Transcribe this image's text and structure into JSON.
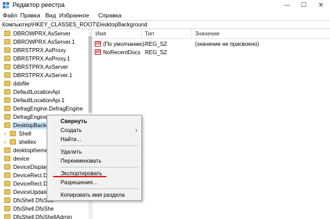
{
  "window": {
    "title": "Редактор реестра",
    "minimize_glyph": "—",
    "maximize_glyph": "☐",
    "close_glyph": "✕"
  },
  "menu": [
    "Файл",
    "Правка",
    "Вид",
    "Избранное",
    "Справка"
  ],
  "address": "Компьютер\\HKEY_CLASSES_ROOT\\DesktopBackground",
  "tree": {
    "items": [
      {
        "label": "DBROWPRX.AsServer"
      },
      {
        "label": "DBROWPRX.AsServer.1"
      },
      {
        "label": "DBRSTPRX.AsProxy"
      },
      {
        "label": "DBRSTPRX.AsProxy.1"
      },
      {
        "label": "DBRSTPRX.AsServer"
      },
      {
        "label": "DBRSTPRX.AsServer.1"
      },
      {
        "label": "ddsfile"
      },
      {
        "label": "DefaultLocationApi"
      },
      {
        "label": "DefaultLocationApi.1"
      },
      {
        "label": "DefragEngine.DefragEngine"
      },
      {
        "label": "DefragEngine.DefragEngine.1"
      },
      {
        "label": "DesktopBackground"
      },
      {
        "label": "Shell"
      },
      {
        "label": "shellex"
      },
      {
        "label": "desktoptheme"
      },
      {
        "label": "device"
      },
      {
        "label": "DeviceDisplayO"
      },
      {
        "label": "DeviceRect.Dev"
      },
      {
        "label": "DeviceRect.Dev"
      },
      {
        "label": "DeviceUpdate"
      },
      {
        "label": "DfsShell.DfsShe"
      },
      {
        "label": "DfsShell.DfsShe"
      },
      {
        "label": "DfsShell.DfsShellAdmin"
      }
    ]
  },
  "list": {
    "headers": {
      "name": "Имя",
      "type": "Тип",
      "value": "Значение"
    },
    "rows": [
      {
        "icon": "ab",
        "name": "(По умолчанию)",
        "type": "REG_SZ",
        "value": "(значение не присвоено)"
      },
      {
        "icon": "ab",
        "name": "NoRecentDocs",
        "type": "REG_SZ",
        "value": ""
      }
    ]
  },
  "context_menu": {
    "items": [
      {
        "label": "Свернуть"
      },
      {
        "label": "Создать",
        "arrow": "›"
      },
      {
        "label": "Найти..."
      },
      {
        "label": "Удалить"
      },
      {
        "label": "Переименовать"
      },
      {
        "label": "Экспортировать"
      },
      {
        "label": "Разрешения..."
      },
      {
        "label": "Копировать имя раздела"
      }
    ]
  },
  "colors": {
    "folder": "#e8c25a",
    "selection": "#cce8ff",
    "highlight_underline": "#e02020"
  }
}
